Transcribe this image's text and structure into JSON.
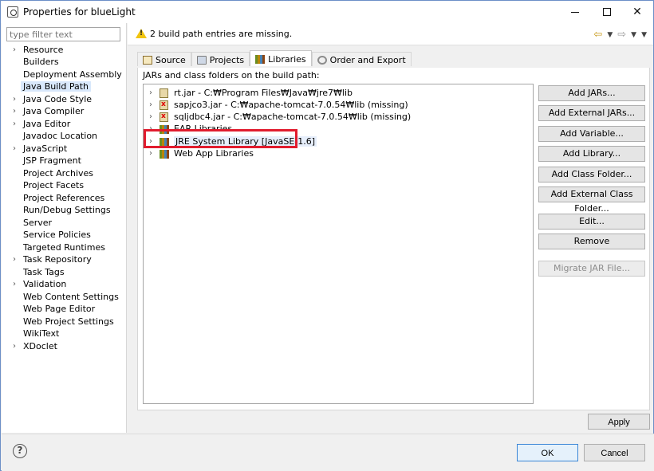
{
  "window": {
    "title": "Properties for blueLight"
  },
  "filter": {
    "placeholder": "type filter text"
  },
  "sidebar": {
    "items": [
      {
        "label": "Resource",
        "expandable": true
      },
      {
        "label": "Builders",
        "expandable": false
      },
      {
        "label": "Deployment Assembly",
        "expandable": false
      },
      {
        "label": "Java Build Path",
        "expandable": false,
        "selected": true
      },
      {
        "label": "Java Code Style",
        "expandable": true
      },
      {
        "label": "Java Compiler",
        "expandable": true
      },
      {
        "label": "Java Editor",
        "expandable": true
      },
      {
        "label": "Javadoc Location",
        "expandable": false
      },
      {
        "label": "JavaScript",
        "expandable": true
      },
      {
        "label": "JSP Fragment",
        "expandable": false
      },
      {
        "label": "Project Archives",
        "expandable": false
      },
      {
        "label": "Project Facets",
        "expandable": false
      },
      {
        "label": "Project References",
        "expandable": false
      },
      {
        "label": "Run/Debug Settings",
        "expandable": false
      },
      {
        "label": "Server",
        "expandable": false
      },
      {
        "label": "Service Policies",
        "expandable": false
      },
      {
        "label": "Targeted Runtimes",
        "expandable": false
      },
      {
        "label": "Task Repository",
        "expandable": true
      },
      {
        "label": "Task Tags",
        "expandable": false
      },
      {
        "label": "Validation",
        "expandable": true
      },
      {
        "label": "Web Content Settings",
        "expandable": false
      },
      {
        "label": "Web Page Editor",
        "expandable": false
      },
      {
        "label": "Web Project Settings",
        "expandable": false
      },
      {
        "label": "WikiText",
        "expandable": false
      },
      {
        "label": "XDoclet",
        "expandable": true
      }
    ]
  },
  "message": {
    "text": "2 build path entries are missing."
  },
  "tabs": [
    {
      "label": "Source",
      "icon": "source-folder-icon"
    },
    {
      "label": "Projects",
      "icon": "projects-icon"
    },
    {
      "label": "Libraries",
      "icon": "libraries-icon",
      "active": true
    },
    {
      "label": "Order and Export",
      "icon": "order-export-icon"
    }
  ],
  "libraries": {
    "heading": "JARs and class folders on the build path:",
    "entries": [
      {
        "label": "rt.jar - C:₩Program Files₩Java₩jre7₩lib",
        "type": "jar",
        "missing": false
      },
      {
        "label": "sapjco3.jar - C:₩apache-tomcat-7.0.54₩lib (missing)",
        "type": "jar",
        "missing": true
      },
      {
        "label": "sqljdbc4.jar - C:₩apache-tomcat-7.0.54₩lib (missing)",
        "type": "jar",
        "missing": true
      },
      {
        "label": "EAR Libraries",
        "type": "library",
        "missing": false
      },
      {
        "label": "JRE System Library [JavaSE-1.6]",
        "type": "library",
        "missing": false,
        "highlighted": true
      },
      {
        "label": "Web App Libraries",
        "type": "library",
        "missing": false
      }
    ]
  },
  "buttons": {
    "add_jars": "Add JARs...",
    "add_external_jars": "Add External JARs...",
    "add_variable": "Add Variable...",
    "add_library": "Add Library...",
    "add_class_folder": "Add Class Folder...",
    "add_external_class_folder": "Add External Class Folder...",
    "edit": "Edit...",
    "remove": "Remove",
    "migrate_jar": "Migrate JAR File...",
    "apply": "Apply",
    "ok": "OK",
    "cancel": "Cancel"
  },
  "colors": {
    "highlight_box": "#e11c2e",
    "selection": "#d9e8fb",
    "warning": "#f1c40f"
  }
}
